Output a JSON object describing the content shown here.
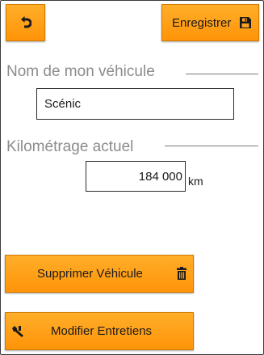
{
  "header": {
    "back_icon": "undo-arrow-icon",
    "save_label": "Enregistrer",
    "save_icon": "floppy-disk-icon"
  },
  "vehicle_name": {
    "title": "Nom de mon véhicule",
    "value": "Scénic"
  },
  "mileage": {
    "title": "Kilométrage actuel",
    "value": "184 000",
    "unit": "km"
  },
  "actions": {
    "delete_label": "Supprimer Véhicule",
    "delete_icon": "trash-icon",
    "edit_label": "Modifier Entretiens",
    "edit_icon": "wrench-icon"
  },
  "colors": {
    "button_accent": "#ff9f1a",
    "section_title": "#8c8c8c"
  }
}
